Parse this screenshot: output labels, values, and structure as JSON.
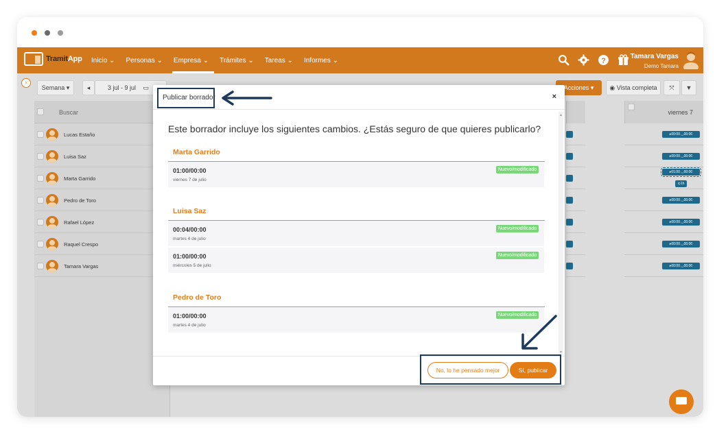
{
  "app": {
    "logo_text": "Tramit",
    "logo_text_accent": "App",
    "nav": [
      "Inicio ⌄",
      "Personas ⌄",
      "Empresa ⌄",
      "Trámites ⌄",
      "Tareas ⌄",
      "Informes ⌄"
    ],
    "user_name": "Tamara Vargas",
    "user_company": "Demo Tamara"
  },
  "toolbar": {
    "view_select": "Semana ▾",
    "prev": "◂",
    "date_range": "3 jul - 9 jul",
    "calendar_icon": "▭",
    "actions": "Acciones ▾",
    "full_view": "Vista completa",
    "expand": "⤧",
    "filter": "▼"
  },
  "grid": {
    "search_label": "Buscar",
    "day_header": "viernes 7",
    "people": [
      "Lucas Estaño",
      "Luisa Saz",
      "Marta Garrido",
      "Pedro de Toro",
      "Rafael López",
      "Raquel Crespo",
      "Tamara Vargas"
    ],
    "shift_label": "▸00:00  ◡00:00",
    "shift_extra": "▸01:00  ◡00:00",
    "shift_hours": "⊙1h"
  },
  "modal": {
    "title": "Publicar borrador",
    "close": "×",
    "question": "Este borrador incluye los siguientes cambios. ¿Estás seguro de que quieres publicarlo?",
    "badge": "Nuevo/modificado",
    "groups": [
      {
        "person": "Marta Garrido",
        "changes": [
          {
            "time": "01:00/00:00",
            "date": "viernes 7 de julio"
          }
        ]
      },
      {
        "person": "Luisa Saz",
        "changes": [
          {
            "time": "00:04/00:00",
            "date": "martes 4 de julio"
          },
          {
            "time": "01:00/00:00",
            "date": "miércoles 5 de julio"
          }
        ]
      },
      {
        "person": "Pedro de Toro",
        "changes": [
          {
            "time": "01:00/00:00",
            "date": "martes 4 de julio"
          }
        ]
      }
    ],
    "cancel_button": "No, lo he pensado mejor",
    "confirm_button": "Sí, publicar"
  },
  "colors": {
    "brand": "#d2791e",
    "accent": "#e47c16",
    "badge": "#79d77a",
    "highlight": "#1d3a5c",
    "shift": "#1e6a8c"
  }
}
